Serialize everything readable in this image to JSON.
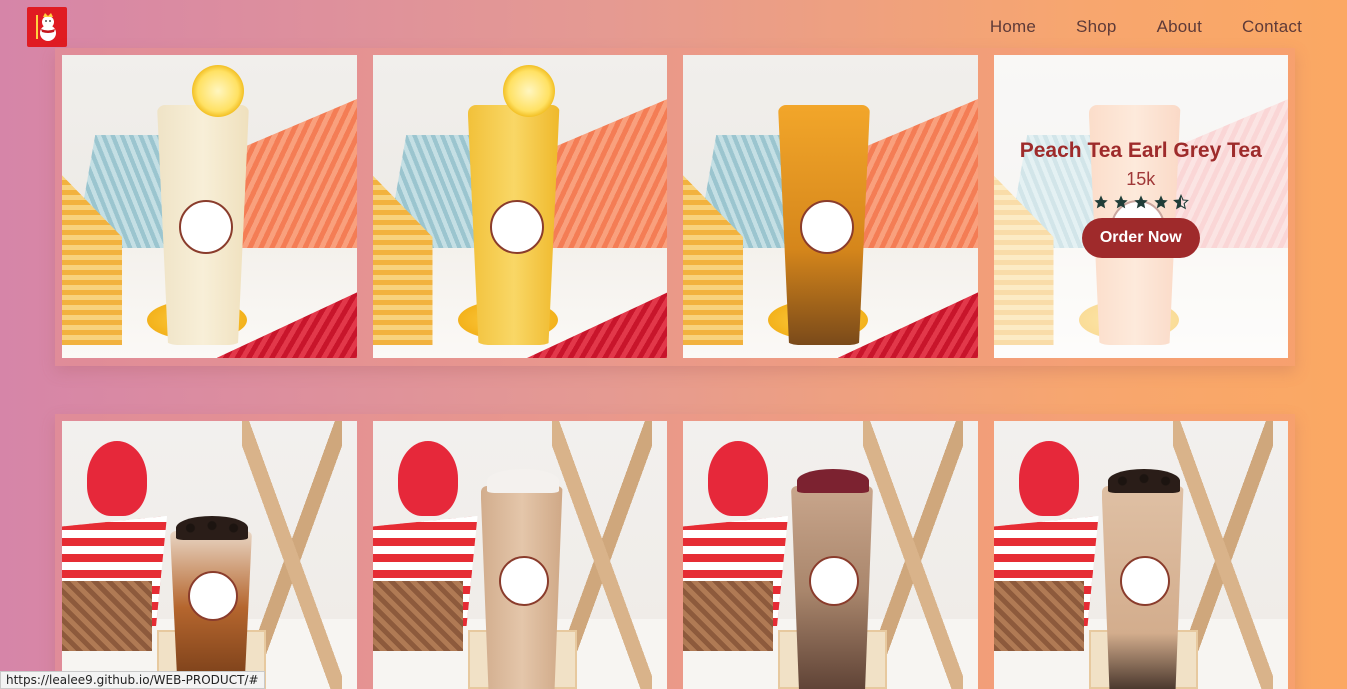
{
  "header": {
    "logo_icon": "snowman-king-logo-icon",
    "brand_color": "#e01b22",
    "nav": [
      {
        "label": "Home"
      },
      {
        "label": "Shop"
      },
      {
        "label": "About"
      },
      {
        "label": "Contact"
      }
    ]
  },
  "featured_product": {
    "title": "Peach Tea Earl Grey Tea",
    "price": "15k",
    "rating": 4.5,
    "rating_max": 5,
    "button_label": "Order Now",
    "accent_color": "#9f2a2b"
  },
  "products_row1": [
    {
      "image": "lemon-tea-cup-image",
      "drink_color": "#f6e6b8"
    },
    {
      "image": "honey-lemon-tea-cup-image",
      "drink_color": "#f4c640"
    },
    {
      "image": "passion-fruit-tea-cup-image",
      "drink_color": "#d98a18"
    },
    {
      "image": "peach-earl-grey-tea-cup-image",
      "drink_color": "#f5b98e"
    }
  ],
  "products_row2": [
    {
      "image": "brown-sugar-boba-cup-image",
      "drink_color": "#b5662e"
    },
    {
      "image": "milk-tea-jelly-cup-image",
      "drink_color": "#dcb99a"
    },
    {
      "image": "grass-jelly-milk-tea-cup-image",
      "drink_color": "#c49a7c"
    },
    {
      "image": "pearl-milk-tea-cup-image",
      "drink_color": "#d8b294"
    }
  ],
  "status_bar": {
    "url": "https://lealee9.github.io/WEB-PRODUCT/#"
  }
}
